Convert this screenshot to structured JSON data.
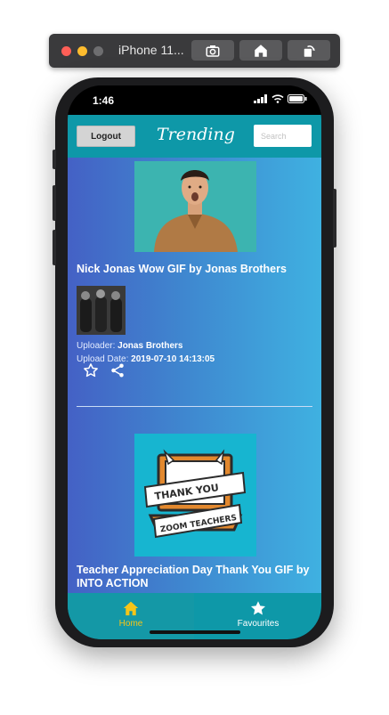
{
  "simulator": {
    "title": "iPhone 11...",
    "buttons": [
      "screenshot",
      "home",
      "rotate"
    ]
  },
  "status_bar": {
    "time": "1:46"
  },
  "app_bar": {
    "logout_label": "Logout",
    "title": "Trending",
    "search_placeholder": "Search"
  },
  "feed": [
    {
      "title": "Nick Jonas Wow GIF by Jonas Brothers",
      "uploader_label": "Uploader:",
      "uploader": "Jonas Brothers",
      "date_label": "Upload Date:",
      "upload_date": "2019-07-10 14:13:05"
    },
    {
      "title": "Teacher Appreciation Day Thank You GIF by INTO ACTION",
      "banner_text_1": "THANK YOU",
      "banner_text_2": "ZOOM TEACHERS"
    }
  ],
  "tabs": [
    {
      "label": "Home",
      "icon": "home-icon",
      "active": true,
      "color": "#f5c518"
    },
    {
      "label": "Favourites",
      "icon": "star-icon",
      "active": false,
      "color": "#ffffff"
    }
  ],
  "colors": {
    "app_bar": "#0e98a8",
    "gradient_start": "#4461c5",
    "gradient_end": "#3fb1e1",
    "active_tab": "#f5c518"
  }
}
